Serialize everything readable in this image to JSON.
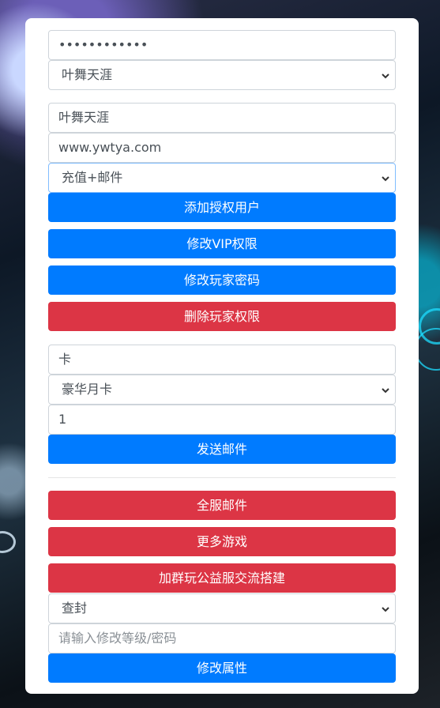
{
  "colors": {
    "primary": "#007bff",
    "danger": "#dc3545"
  },
  "password_field": {
    "value": "••••••••••••"
  },
  "server_select": {
    "value": "叶舞天涯"
  },
  "username_field": {
    "value": "叶舞天涯"
  },
  "site_field": {
    "value": "www.ywtya.com"
  },
  "permission_select": {
    "value": "充值+邮件"
  },
  "buttons": {
    "add_auth": "添加授权用户",
    "modify_vip": "修改VIP权限",
    "modify_password": "修改玩家密码",
    "delete_permission": "删除玩家权限",
    "send_mail": "发送邮件",
    "all_server_mail": "全服邮件",
    "more_games": "更多游戏",
    "join_group": "加群玩公益服交流搭建",
    "modify_attr": "修改属性"
  },
  "item_search_field": {
    "value": "卡"
  },
  "item_select": {
    "value": "豪华月卡"
  },
  "quantity_field": {
    "value": "1"
  },
  "action_select": {
    "value": "查封"
  },
  "attr_field": {
    "placeholder": "请输入修改等级/密码"
  }
}
